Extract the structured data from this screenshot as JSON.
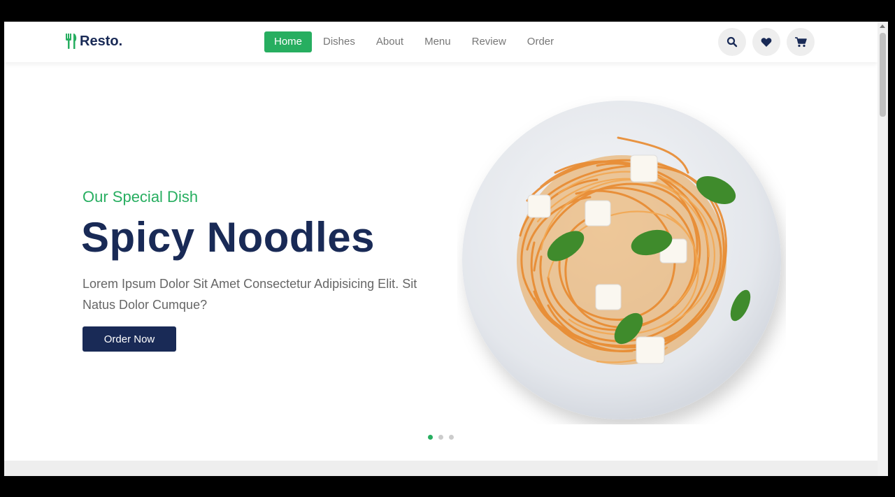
{
  "header": {
    "logo_text": "Resto.",
    "nav": [
      {
        "label": "Home",
        "active": true
      },
      {
        "label": "Dishes",
        "active": false
      },
      {
        "label": "About",
        "active": false
      },
      {
        "label": "Menu",
        "active": false
      },
      {
        "label": "Review",
        "active": false
      },
      {
        "label": "Order",
        "active": false
      }
    ],
    "icons": [
      "search-icon",
      "heart-icon",
      "cart-icon"
    ]
  },
  "hero": {
    "subtitle": "Our Special Dish",
    "title": "Spicy Noodles",
    "description": "Lorem Ipsum Dolor Sit Amet Consectetur Adipisicing Elit. Sit Natus Dolor Cumque?",
    "button_label": "Order Now",
    "image": "spaghetti-plate",
    "slides_total": 3,
    "slide_active": 1
  },
  "colors": {
    "accent": "#27ae60",
    "primary": "#192a56",
    "text_muted": "#666666"
  }
}
